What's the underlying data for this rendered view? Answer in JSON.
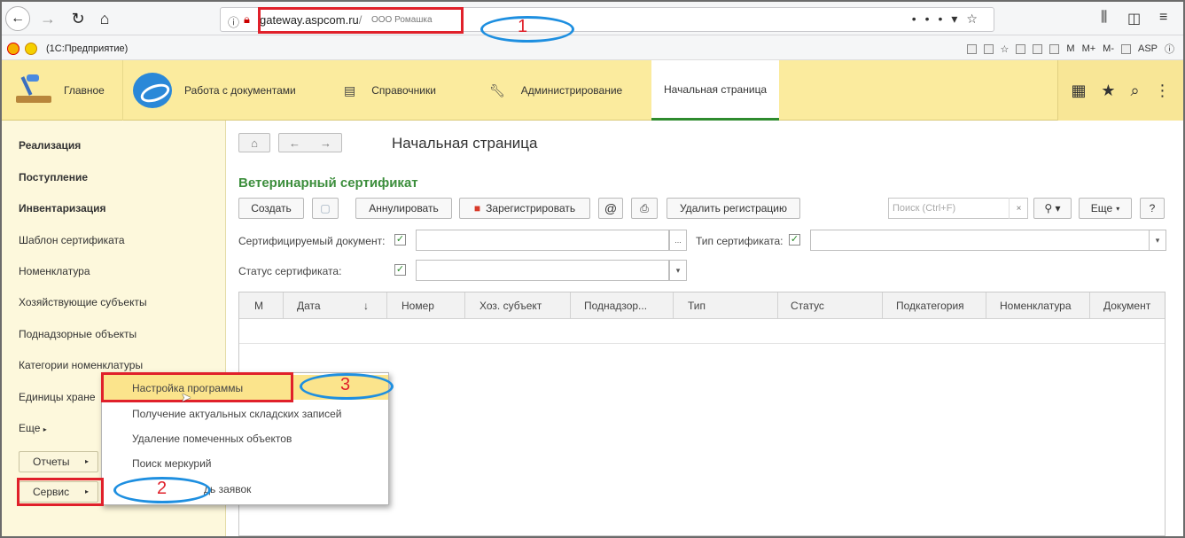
{
  "browser": {
    "url_host": "gateway.aspcom.ru",
    "url_path": "/",
    "org": "ООО Ромашка",
    "menu_icons": [
      "library-icon",
      "sidebar-icon",
      "hamburger-icon"
    ]
  },
  "onec_bar": {
    "title": "(1С:Предприятие)",
    "icons": [
      "M",
      "M+",
      "M-",
      "ASP"
    ]
  },
  "sections": [
    {
      "label": "Главное",
      "icon": "desk-icon"
    },
    {
      "label": "Работа с документами",
      "icon": "documents-icon"
    },
    {
      "label": "Справочники",
      "icon": "reference-book-icon"
    },
    {
      "label": "Администрирование",
      "icon": "wrench-icon"
    },
    {
      "label": "Начальная страница",
      "icon": ""
    }
  ],
  "sidebar": {
    "items": [
      {
        "label": "Реализация",
        "bold": true
      },
      {
        "label": "Поступление",
        "bold": true
      },
      {
        "label": "Инвентаризация",
        "bold": true
      },
      {
        "label": "Шаблон сертификата",
        "bold": false
      },
      {
        "label": "Номенклатура",
        "bold": false
      },
      {
        "label": "Хозяйствующие субъекты",
        "bold": false
      },
      {
        "label": "Поднадзорные объекты",
        "bold": false
      },
      {
        "label": "Категории номенклатуры",
        "bold": false
      },
      {
        "label": "Единицы хране",
        "bold": false
      },
      {
        "label": "Еще",
        "bold": false
      }
    ],
    "reports_button": "Отчеты",
    "service_button": "Сервис"
  },
  "main": {
    "page_title": "Начальная страница",
    "form_title": "Ветеринарный сертификат",
    "buttons": {
      "create": "Создать",
      "annul": "Аннулировать",
      "register": "Зарегистрировать",
      "at": "@",
      "delete_registration": "Удалить регистрацию",
      "more": "Еще",
      "help": "?"
    },
    "search_placeholder": "Поиск (Ctrl+F)",
    "filters": {
      "doc_label": "Сертифицируемый документ:",
      "type_label": "Тип сертификата:",
      "status_label": "Статус сертификата:",
      "doc_value": "",
      "type_value": "",
      "status_value": ""
    },
    "table": {
      "columns": [
        "М",
        "Дата",
        "↓",
        "Номер",
        "Хоз. субъект",
        "Поднадзор...",
        "Тип",
        "Статус",
        "Подкатегория",
        "Номенклатура",
        "Документ"
      ],
      "rows": []
    }
  },
  "popup_menu": {
    "items": [
      "Настройка программы",
      "Получение актуальных складских записей",
      "Удаление помеченных объектов",
      "Поиск меркурий",
      "дь заявок"
    ],
    "highlighted_index": 0
  },
  "annotations": {
    "n1": "1",
    "n2": "2",
    "n3": "3",
    "box_color": "#e0202a",
    "ellipse_color": "#1e8fe0"
  }
}
